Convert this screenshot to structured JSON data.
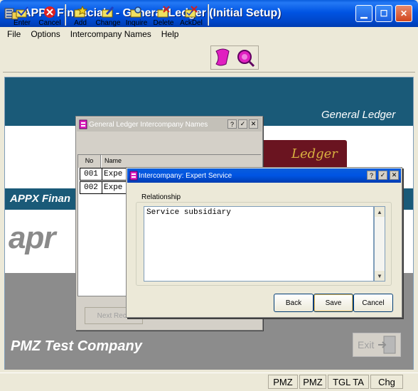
{
  "window": {
    "title": "APPX Financials - General Ledger (Initial Setup)",
    "icons": {
      "app": "appx-icon",
      "minimize": "minimize-icon",
      "maximize": "maximize-icon",
      "close": "close-icon"
    }
  },
  "menu": [
    "File",
    "Options",
    "Intercompany Names",
    "Help"
  ],
  "toolbar": {
    "enter": "Enter",
    "cancel": "Cancel",
    "add": "Add",
    "change": "Change",
    "inquire": "Inquire",
    "delete": "Delete",
    "ackdel": "AckDel"
  },
  "background": {
    "gl_label": "General Ledger",
    "appx_fin": "APPX Finan",
    "logo": "apr",
    "ledger_book": "Ledger",
    "company": "PMZ Test Company",
    "exit": "Exit"
  },
  "names_dialog": {
    "title": "General Ledger Intercompany Names",
    "title_buttons": [
      "?",
      "✓",
      "✕"
    ],
    "columns": {
      "no": "No",
      "name": "Name"
    },
    "rows": [
      {
        "no": "001",
        "name": "Expe"
      },
      {
        "no": "002",
        "name": "Expe"
      }
    ],
    "next_record": "Next Reco"
  },
  "detail_dialog": {
    "title": "Intercompany: Expert Service",
    "title_buttons": [
      "?",
      "✓",
      "✕"
    ],
    "group_label": "Relationship",
    "relationship_value": "Service subsidiary",
    "buttons": {
      "back": "Back",
      "save": "Save",
      "cancel": "Cancel"
    }
  },
  "statusbar": [
    "PMZ",
    "PMZ",
    "TGL TA",
    "Chg"
  ]
}
